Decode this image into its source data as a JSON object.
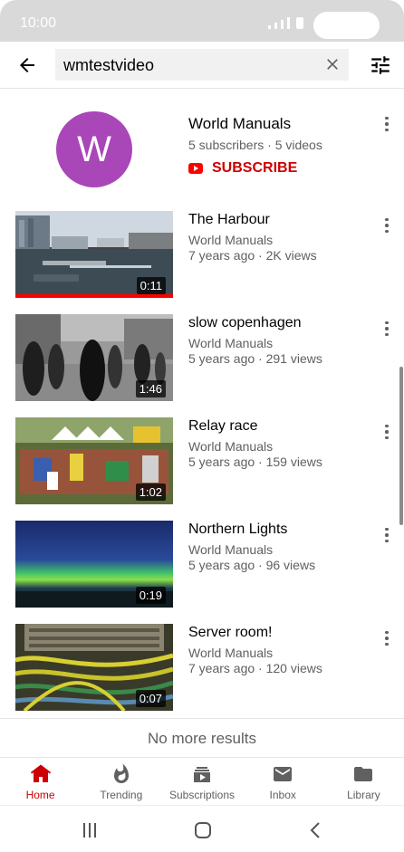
{
  "status_bar": {
    "time": "10:00"
  },
  "search": {
    "query": "wmtestvideo"
  },
  "channel": {
    "avatar_letter": "W",
    "avatar_color": "#a946b8",
    "name": "World Manuals",
    "meta": "5 subscribers · 5 videos",
    "subscribe_label": "SUBSCRIBE"
  },
  "videos": [
    {
      "title": "The Harbour",
      "channel": "World Manuals",
      "meta": "7 years ago · 2K views",
      "duration": "0:11",
      "watched_fraction": 1.0
    },
    {
      "title": "slow copenhagen",
      "channel": "World Manuals",
      "meta": "5 years ago · 291 views",
      "duration": "1:46"
    },
    {
      "title": "Relay race",
      "channel": "World Manuals",
      "meta": "5 years ago · 159 views",
      "duration": "1:02"
    },
    {
      "title": "Northern Lights",
      "channel": "World Manuals",
      "meta": "5 years ago · 96 views",
      "duration": "0:19"
    },
    {
      "title": "Server room!",
      "channel": "World Manuals",
      "meta": "7 years ago · 120 views",
      "duration": "0:07"
    }
  ],
  "end_message": "No more results",
  "bottom_nav": {
    "home": "Home",
    "trending": "Trending",
    "subscriptions": "Subscriptions",
    "inbox": "Inbox",
    "library": "Library"
  },
  "colors": {
    "accent": "#cc0000",
    "brand_red": "#ff0000"
  }
}
